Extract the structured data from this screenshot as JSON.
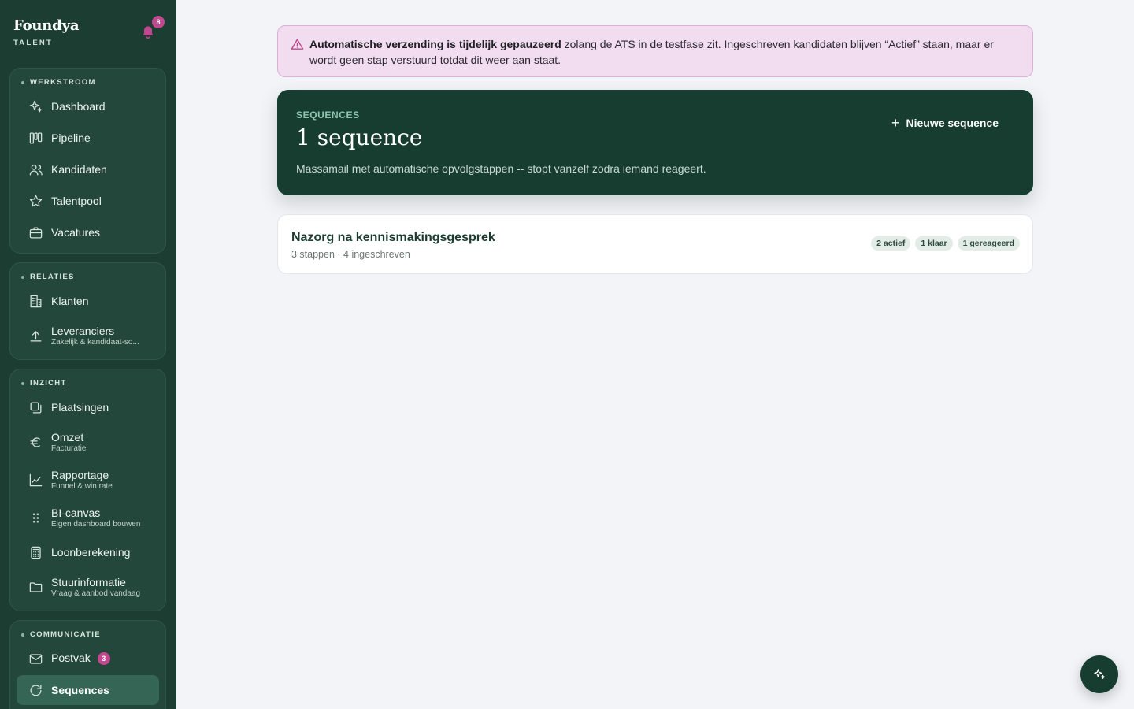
{
  "brand": {
    "name": "Foundya",
    "sub": "TALENT",
    "notifications": "8"
  },
  "sidebar": {
    "groups": [
      {
        "title": "WERKSTROOM",
        "items": [
          {
            "label": "Dashboard",
            "icon": "sparkles-icon"
          },
          {
            "label": "Pipeline",
            "icon": "kanban-icon"
          },
          {
            "label": "Kandidaten",
            "icon": "users-icon"
          },
          {
            "label": "Talentpool",
            "icon": "star-icon"
          },
          {
            "label": "Vacatures",
            "icon": "briefcase-icon"
          }
        ]
      },
      {
        "title": "RELATIES",
        "items": [
          {
            "label": "Klanten",
            "icon": "building-icon"
          },
          {
            "label": "Leveranciers",
            "sub": "Zakelijk & kandidaat-so...",
            "icon": "upload-icon"
          }
        ]
      },
      {
        "title": "INZICHT",
        "items": [
          {
            "label": "Plaatsingen",
            "icon": "copy-icon"
          },
          {
            "label": "Omzet",
            "sub": "Facturatie",
            "icon": "euro-icon"
          },
          {
            "label": "Rapportage",
            "sub": "Funnel & win rate",
            "icon": "line-chart-icon"
          },
          {
            "label": "BI-canvas",
            "sub": "Eigen dashboard bouwen",
            "icon": "grip-icon"
          },
          {
            "label": "Loonberekening",
            "icon": "calculator-icon"
          },
          {
            "label": "Stuurinformatie",
            "sub": "Vraag & aanbod vandaag",
            "icon": "folder-icon"
          }
        ]
      },
      {
        "title": "COMMUNICATIE",
        "items": [
          {
            "label": "Postvak",
            "badge": "3",
            "icon": "mail-icon"
          },
          {
            "label": "Sequences",
            "icon": "refresh-icon",
            "active": true
          }
        ]
      }
    ]
  },
  "alert": {
    "bold": "Automatische verzending is tijdelijk gepauzeerd",
    "rest": " zolang de ATS in de testfase zit. Ingeschreven kandidaten blijven “Actief” staan, maar er wordt geen stap verstuurd totdat dit weer aan staat."
  },
  "hero": {
    "eyebrow": "SEQUENCES",
    "title": "1 sequence",
    "description": "Massamail met automatische opvolgstappen -- stopt vanzelf zodra iemand reageert.",
    "new_button": "Nieuwe sequence"
  },
  "sequences": [
    {
      "title": "Nazorg na kennismakingsgesprek",
      "meta": "3 stappen · 4 ingeschreven",
      "tags": [
        "2 actief",
        "1 klaar",
        "1 gereageerd"
      ]
    }
  ],
  "colors": {
    "sidebar": "#1c3d31",
    "hero": "#163d30",
    "accent_pink": "#c2478e",
    "alert_bg": "#f1dcf0"
  }
}
